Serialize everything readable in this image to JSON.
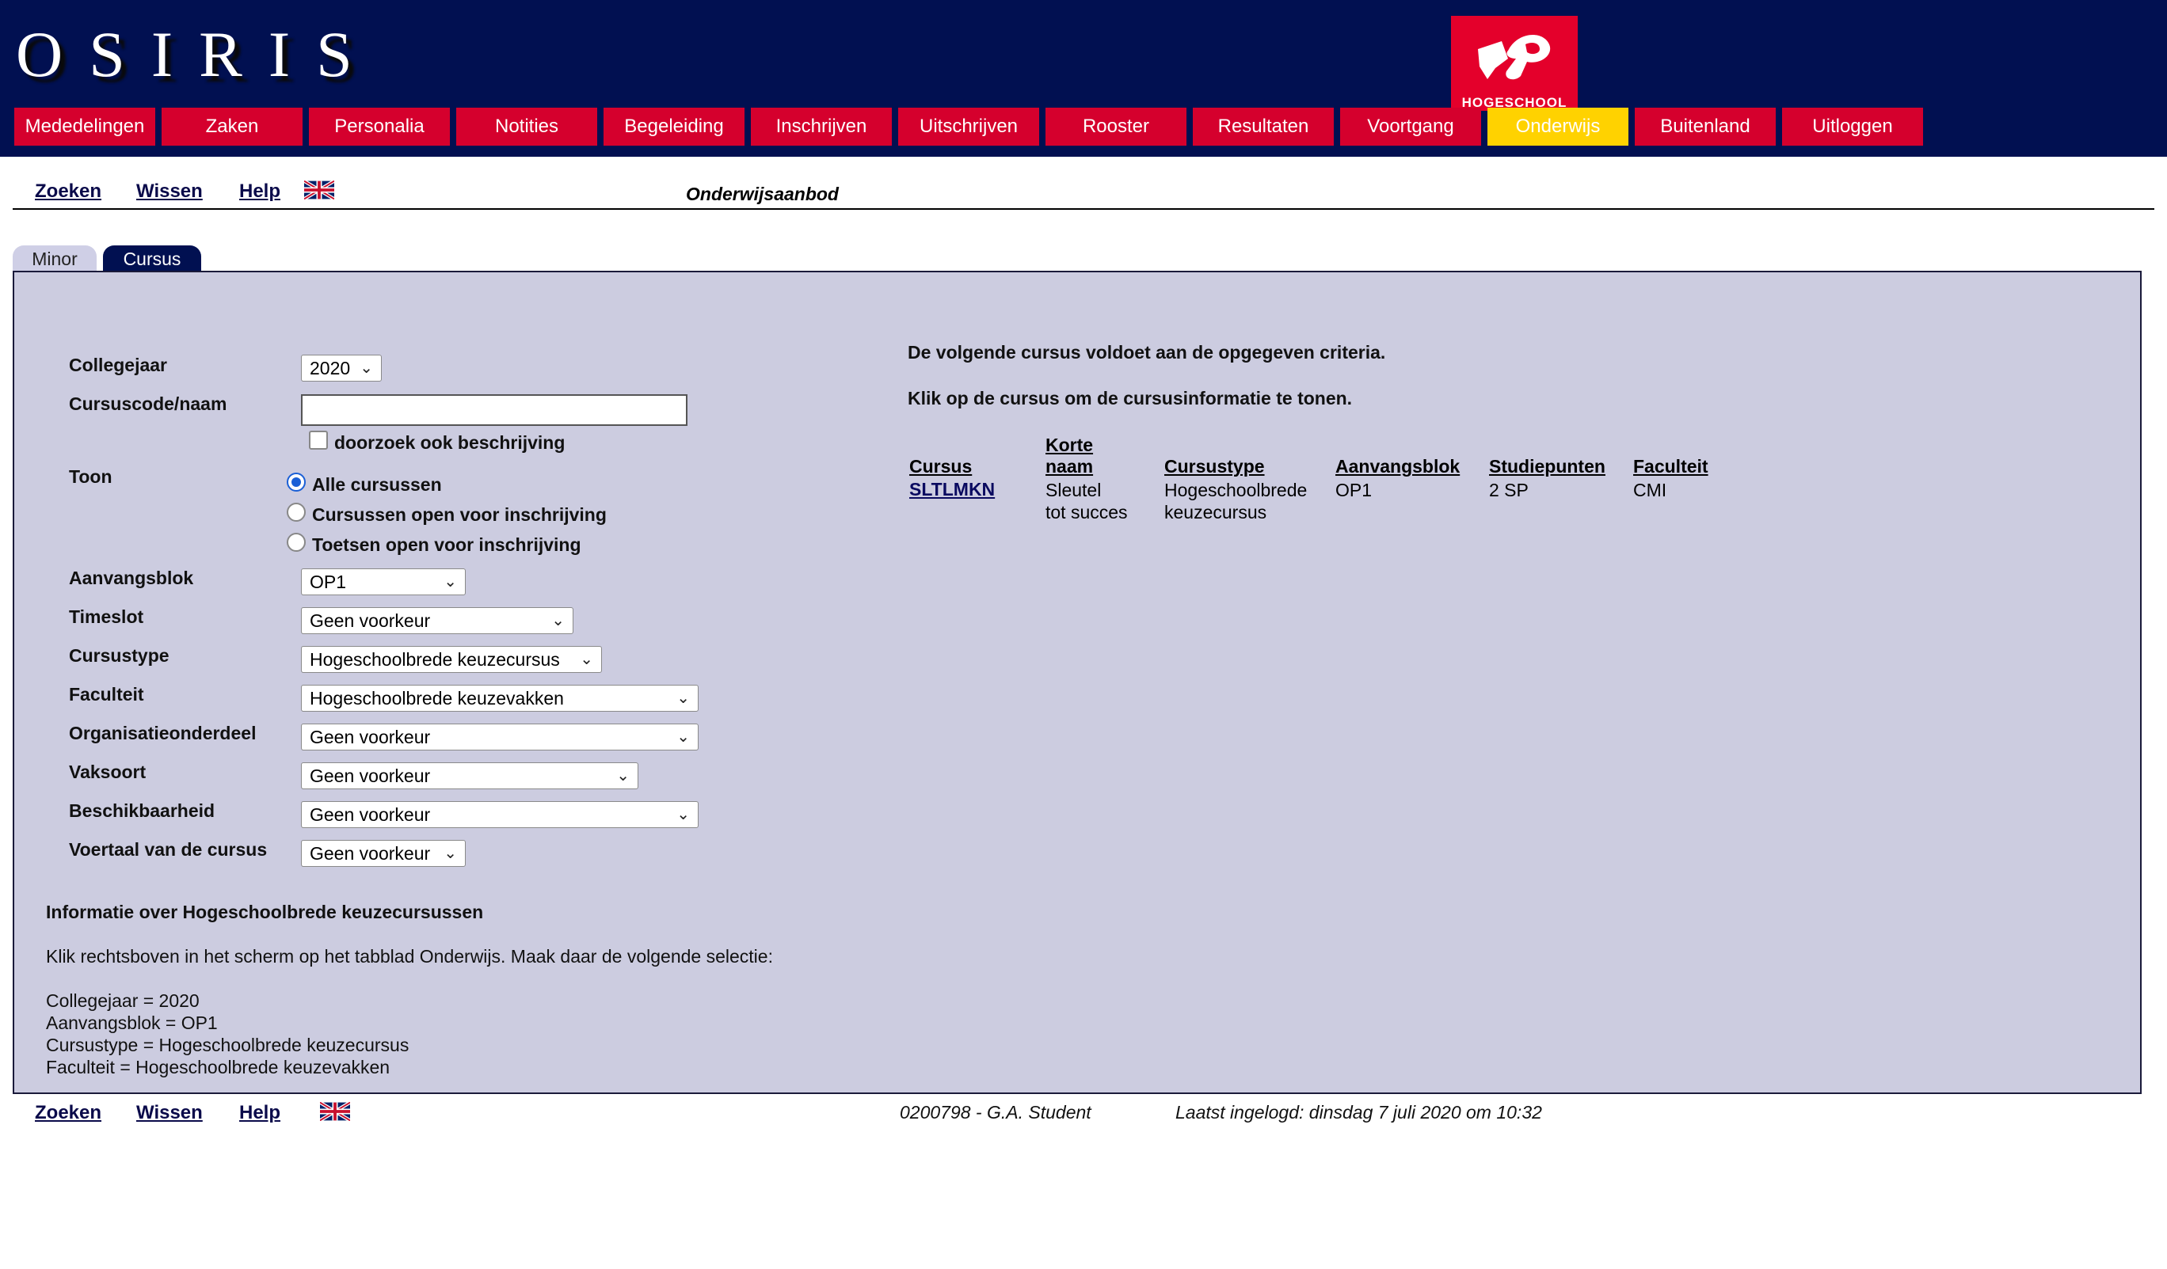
{
  "app": {
    "logo": "OSIRIS",
    "institution_badge": "HOGESCHOOL"
  },
  "menu": [
    {
      "label": "Mededelingen",
      "active": false
    },
    {
      "label": "Zaken",
      "active": false
    },
    {
      "label": "Personalia",
      "active": false
    },
    {
      "label": "Notities",
      "active": false
    },
    {
      "label": "Begeleiding",
      "active": false
    },
    {
      "label": "Inschrijven",
      "active": false
    },
    {
      "label": "Uitschrijven",
      "active": false
    },
    {
      "label": "Rooster",
      "active": false
    },
    {
      "label": "Resultaten",
      "active": false
    },
    {
      "label": "Voortgang",
      "active": false
    },
    {
      "label": "Onderwijs",
      "active": true
    },
    {
      "label": "Buitenland",
      "active": false
    },
    {
      "label": "Uitloggen",
      "active": false
    }
  ],
  "toolbar": {
    "search": "Zoeken",
    "clear": "Wissen",
    "help": "Help",
    "language_icon": "uk-flag-icon"
  },
  "page_title": "Onderwijsaanbod",
  "tabs": [
    {
      "label": "Minor",
      "active": false
    },
    {
      "label": "Cursus",
      "active": true
    }
  ],
  "form": {
    "collegejaar": {
      "label": "Collegejaar",
      "value": "2020"
    },
    "cursuscode": {
      "label": "Cursuscode/naam",
      "value": ""
    },
    "search_description": {
      "label": "doorzoek ook beschrijving",
      "checked": false
    },
    "toon": {
      "label": "Toon",
      "options": [
        "Alle cursussen",
        "Cursussen open voor inschrijving",
        "Toetsen open voor inschrijving"
      ],
      "selected": "Alle cursussen"
    },
    "aanvangsblok": {
      "label": "Aanvangsblok",
      "value": "OP1"
    },
    "timeslot": {
      "label": "Timeslot",
      "value": "Geen voorkeur"
    },
    "cursustype": {
      "label": "Cursustype",
      "value": "Hogeschoolbrede keuzecursus"
    },
    "faculteit": {
      "label": "Faculteit",
      "value": "Hogeschoolbrede keuzevakken"
    },
    "organisatieonderdeel": {
      "label": "Organisatieonderdeel",
      "value": "Geen voorkeur"
    },
    "vaksoort": {
      "label": "Vaksoort",
      "value": "Geen voorkeur"
    },
    "beschikbaarheid": {
      "label": "Beschikbaarheid",
      "value": "Geen voorkeur"
    },
    "voertaal": {
      "label": "Voertaal van de cursus",
      "value": "Geen voorkeur"
    }
  },
  "results": {
    "message": "De volgende cursus voldoet  aan de opgegeven criteria.",
    "hint": "Klik op de cursus om de cursusinformatie te tonen.",
    "columns": {
      "cursus": "Cursus",
      "korte_naam_1": "Korte",
      "korte_naam_2": "naam",
      "cursustype": "Cursustype",
      "aanvangsblok": "Aanvangsblok",
      "studiepunten": "Studiepunten",
      "faculteit": "Faculteit"
    },
    "rows": [
      {
        "cursus": "SLTLMKN",
        "korte_naam_1": "Sleutel",
        "korte_naam_2": "tot succes",
        "cursustype_1": "Hogeschoolbrede",
        "cursustype_2": "keuzecursus",
        "aanvangsblok": "OP1",
        "studiepunten": "2 SP",
        "faculteit": "CMI"
      }
    ]
  },
  "info": {
    "title": "Informatie over Hogeschoolbrede keuzecursussen",
    "instruction": "Klik rechtsboven in het scherm op het tabblad Onderwijs. Maak daar de volgende selectie:",
    "lines": [
      "Collegejaar = 2020",
      "Aanvangsblok = OP1",
      "Cursustype = Hogeschoolbrede keuzecursus",
      "Faculteit = Hogeschoolbrede keuzevakken"
    ]
  },
  "footer": {
    "user": "0200798 - G.A. Student",
    "last_login": "Laatst ingelogd: dinsdag 7 juli 2020 om 10:32"
  }
}
